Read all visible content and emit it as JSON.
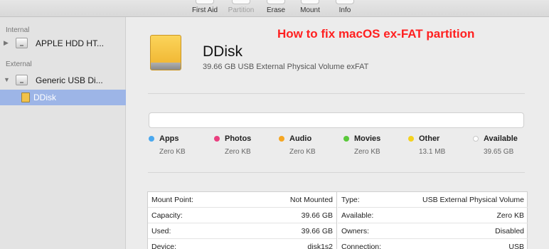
{
  "toolbar": {
    "buttons": [
      {
        "label": "First Aid",
        "enabled": true
      },
      {
        "label": "Partition",
        "enabled": false
      },
      {
        "label": "Erase",
        "enabled": true
      },
      {
        "label": "Mount",
        "enabled": true
      },
      {
        "label": "Info",
        "enabled": true
      }
    ]
  },
  "sidebar": {
    "internal_header": "Internal",
    "external_header": "External",
    "items": [
      {
        "label": "APPLE HDD HT...",
        "icon": "hard-drive-icon",
        "expand": "▶"
      },
      {
        "label": "Generic USB Di...",
        "icon": "usb-disk-icon",
        "expand": "▼"
      },
      {
        "label": "DDisk",
        "icon": "volume-icon",
        "selected": true
      }
    ]
  },
  "overlay": {
    "title": "How to fix macOS ex-FAT partition"
  },
  "volume": {
    "name": "DDisk",
    "description": "39.66 GB USB External Physical Volume exFAT"
  },
  "usage": {
    "legend": [
      {
        "name": "Apps",
        "size": "Zero KB",
        "color": "#4aa8ef"
      },
      {
        "name": "Photos",
        "size": "Zero KB",
        "color": "#ea3f7f"
      },
      {
        "name": "Audio",
        "size": "Zero KB",
        "color": "#f5a623"
      },
      {
        "name": "Movies",
        "size": "Zero KB",
        "color": "#5ac93b"
      },
      {
        "name": "Other",
        "size": "13.1 MB",
        "color": "#f4d21f"
      },
      {
        "name": "Available",
        "size": "39.65 GB",
        "color": "#ffffff"
      }
    ]
  },
  "info": {
    "left": [
      {
        "key": "Mount Point:",
        "value": "Not Mounted"
      },
      {
        "key": "Capacity:",
        "value": "39.66 GB"
      },
      {
        "key": "Used:",
        "value": "39.66 GB"
      },
      {
        "key": "Device:",
        "value": "disk1s2"
      }
    ],
    "right": [
      {
        "key": "Type:",
        "value": "USB External Physical Volume"
      },
      {
        "key": "Available:",
        "value": "Zero KB"
      },
      {
        "key": "Owners:",
        "value": "Disabled"
      },
      {
        "key": "Connection:",
        "value": "USB"
      }
    ]
  }
}
